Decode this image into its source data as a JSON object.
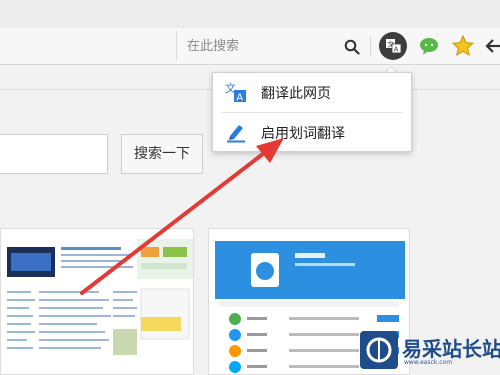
{
  "toolbar": {
    "search": {
      "placeholder": "在此搜索"
    },
    "icons": [
      "search-icon",
      "translate-icon",
      "chat-icon",
      "star-icon",
      "back-icon"
    ],
    "accent": "#3d3d3d"
  },
  "popup": {
    "items": [
      {
        "label": "翻译此网页",
        "icon": "translate-page-icon"
      },
      {
        "label": "启用划词翻译",
        "icon": "highlight-pen-icon"
      }
    ]
  },
  "page": {
    "search_button_label": "搜索一下"
  },
  "watermark": {
    "text": "易采站长站",
    "sub": "www.easck.com"
  },
  "colors": {
    "arrow": "#e53935",
    "icon_blue": "#2a7de1",
    "watermark": "#1f4d8c"
  }
}
